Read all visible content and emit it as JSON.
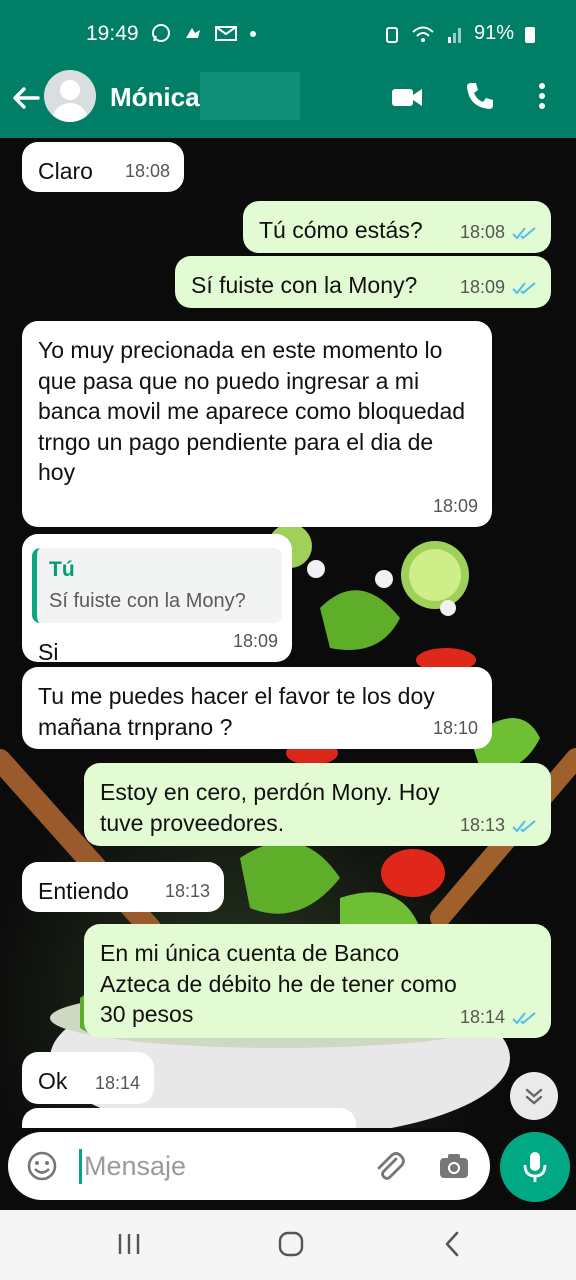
{
  "status_bar": {
    "time": "19:49",
    "battery": "91%"
  },
  "header": {
    "contact_name": "Mónica"
  },
  "messages": [
    {
      "dir": "in",
      "text": "Claro",
      "time": "18:08"
    },
    {
      "dir": "out",
      "text": "Tú cómo estás?",
      "time": "18:08"
    },
    {
      "dir": "out",
      "text": "Sí fuiste con la Mony?",
      "time": "18:09"
    },
    {
      "dir": "in",
      "text": "Yo muy precionada en este momento lo que pasa que no puedo ingresar a mi banca movil me aparece como bloquedad trngo un pago pendiente para el dia de hoy",
      "time": "18:09"
    },
    {
      "dir": "in",
      "quote_name": "Tú",
      "quote_text": "Sí fuiste con la Mony?",
      "text": "Si",
      "time": "18:09"
    },
    {
      "dir": "in",
      "text": "Tu me puedes hacer el favor te los doy mañana trnprano ?",
      "time": "18:10"
    },
    {
      "dir": "out",
      "text": "Estoy en cero, perdón Mony. Hoy tuve proveedores.",
      "time": "18:13"
    },
    {
      "dir": "in",
      "text": "Entiendo",
      "time": "18:13"
    },
    {
      "dir": "out",
      "text": "En mi única cuenta de Banco Azteca de débito he de tener como 30 pesos",
      "time": "18:14"
    },
    {
      "dir": "in",
      "text": "Ok",
      "time": "18:14"
    }
  ],
  "composer": {
    "placeholder": "Mensaje"
  },
  "icons": {
    "header": [
      "back-arrow-icon",
      "avatar",
      "video-call-icon",
      "phone-icon",
      "more-vertical-icon"
    ],
    "composer": [
      "emoji-icon",
      "attach-icon",
      "camera-icon",
      "mic-icon"
    ],
    "nav": [
      "recents-icon",
      "home-icon",
      "back-icon"
    ]
  },
  "colors": {
    "header": "#007f66",
    "accent": "#00a884",
    "outgoing_bubble": "#e3fbd3",
    "incoming_bubble": "#ffffff",
    "read_ticks": "#53bdeb"
  }
}
